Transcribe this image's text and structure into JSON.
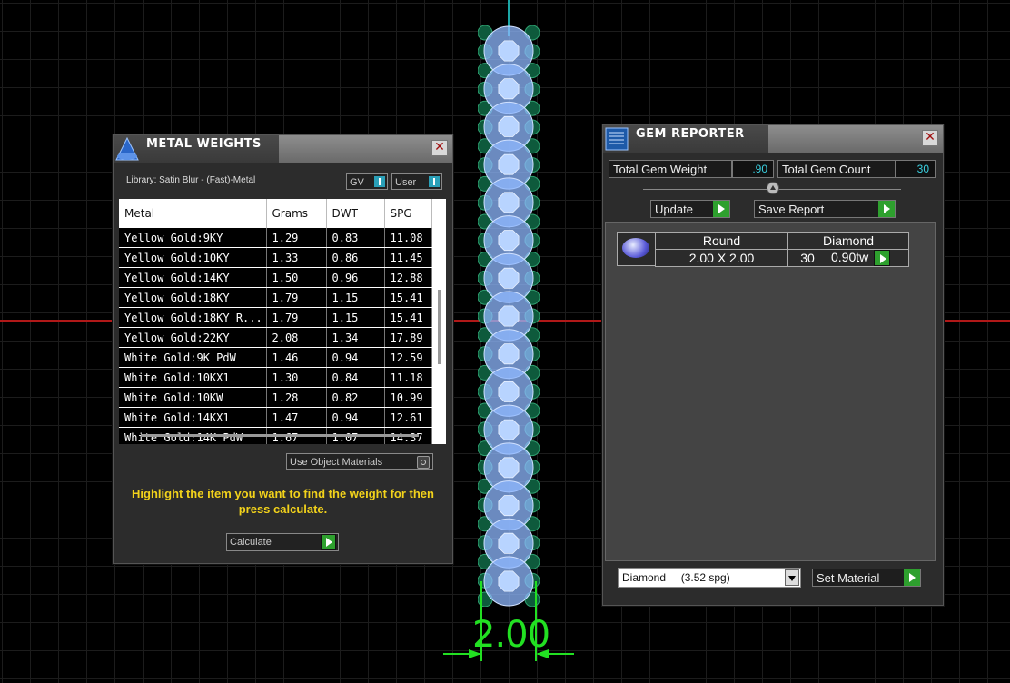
{
  "viewport": {
    "dimension_label": "2.00",
    "gem_count_rendered": 15
  },
  "metal_weights": {
    "title": "METAL WEIGHTS",
    "library_label": "Library: Satin Blur - (Fast)-Metal",
    "toggle_gv": "GV",
    "toggle_user": "User",
    "columns": [
      "Metal",
      "Grams",
      "DWT",
      "SPG"
    ],
    "rows": [
      [
        "Yellow Gold:9KY",
        "1.29",
        "0.83",
        "11.08"
      ],
      [
        "Yellow Gold:10KY",
        "1.33",
        "0.86",
        "11.45"
      ],
      [
        "Yellow Gold:14KY",
        "1.50",
        "0.96",
        "12.88"
      ],
      [
        "Yellow Gold:18KY",
        "1.79",
        "1.15",
        "15.41"
      ],
      [
        "Yellow Gold:18KY R...",
        "1.79",
        "1.15",
        "15.41"
      ],
      [
        "Yellow Gold:22KY",
        "2.08",
        "1.34",
        "17.89"
      ],
      [
        "White Gold:9K PdW",
        "1.46",
        "0.94",
        "12.59"
      ],
      [
        "White Gold:10KX1",
        "1.30",
        "0.84",
        "11.18"
      ],
      [
        "White Gold:10KW",
        "1.28",
        "0.82",
        "10.99"
      ],
      [
        "White Gold:14KX1",
        "1.47",
        "0.94",
        "12.61"
      ],
      [
        "White Gold:14K PdW",
        "1.67",
        "1.07",
        "14.37"
      ]
    ],
    "use_object_materials": "Use Object Materials",
    "hint": "Highlight the item you want to find the weight for then press calculate.",
    "calculate_label": "Calculate"
  },
  "gem_reporter": {
    "title": "GEM REPORTER",
    "total_weight_label": "Total Gem Weight",
    "total_weight_value": ".90",
    "total_count_label": "Total Gem Count",
    "total_count_value": "30",
    "update_label": "Update",
    "save_report_label": "Save Report",
    "gem_row": {
      "shape": "Round",
      "material": "Diamond",
      "size": "2.00 X 2.00",
      "count": "30",
      "weight": "0.90tw"
    },
    "material_select": "Diamond     (3.52 spg)",
    "set_material_label": "Set Material"
  },
  "colors": {
    "accent_green": "#2ea02e",
    "value_cyan": "#3ad0e0",
    "hint_yellow": "#f2d21b",
    "axis_red": "#b01818",
    "dimension_green": "#22e022"
  }
}
